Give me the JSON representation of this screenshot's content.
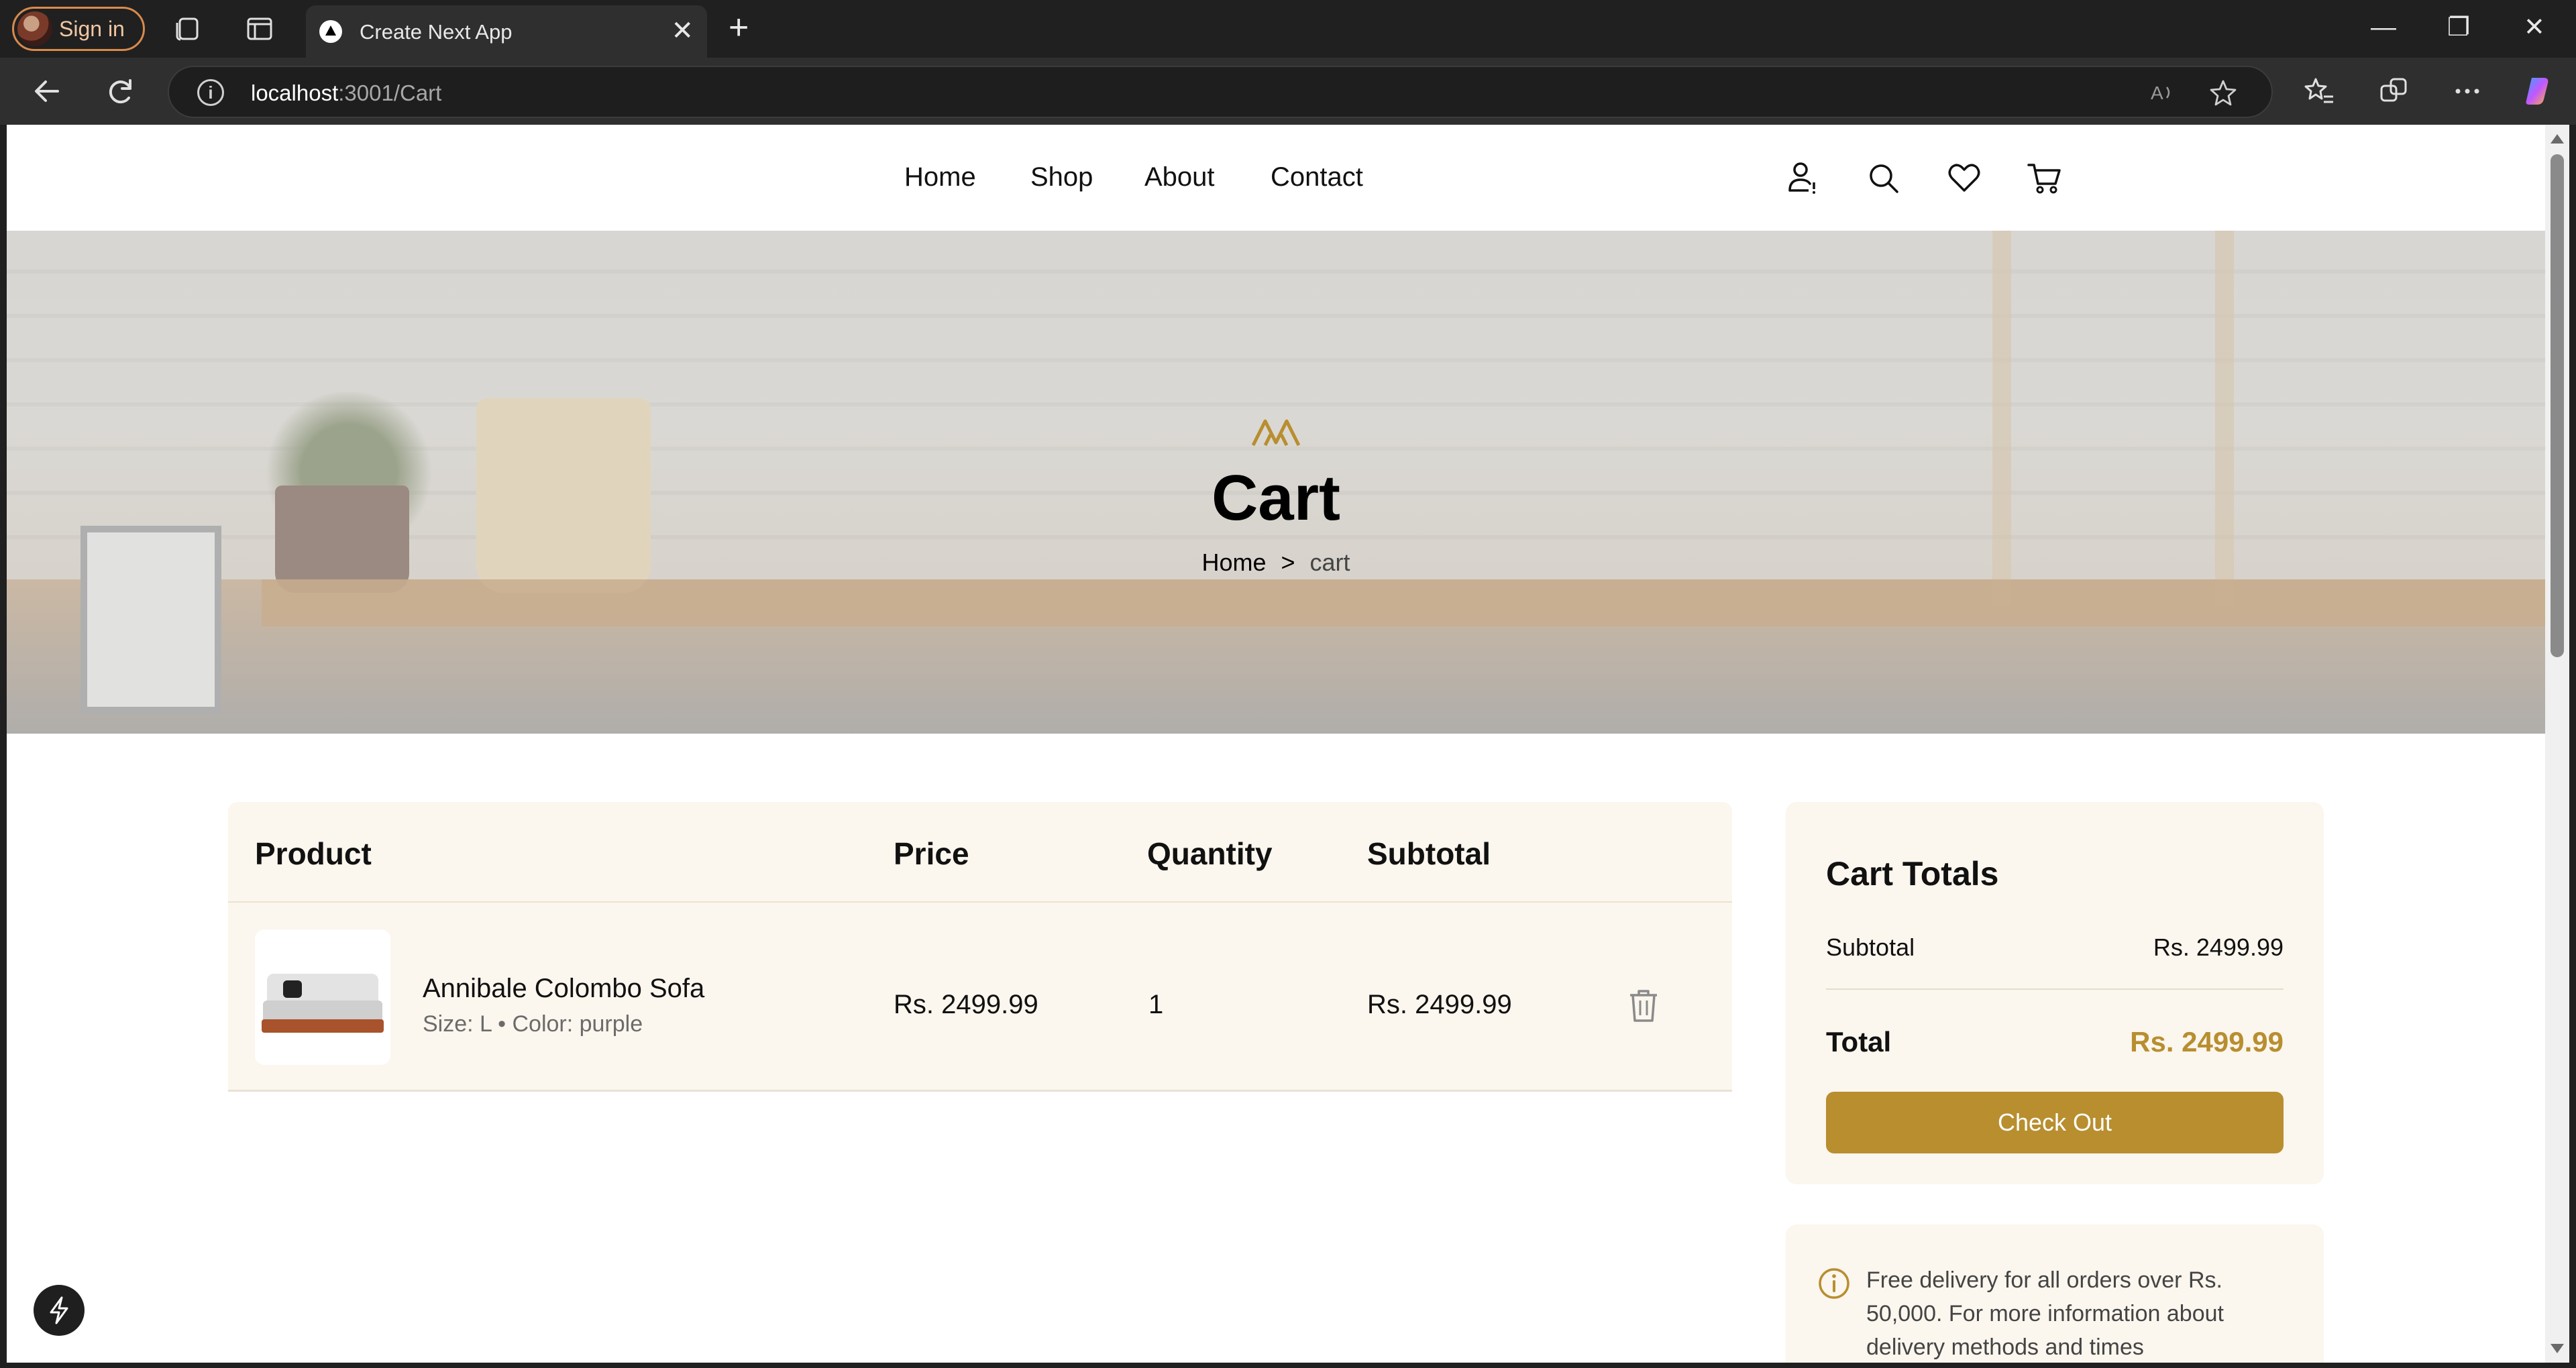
{
  "browser": {
    "signin_label": "Sign in",
    "tab_title": "Create Next App",
    "tab_close": "✕",
    "new_tab": "+",
    "url_host": "localhost",
    "url_path": ":3001/Cart",
    "win_min": "—",
    "win_restore": "❐",
    "win_close": "✕"
  },
  "header": {
    "nav": [
      "Home",
      "Shop",
      "About",
      "Contact"
    ]
  },
  "hero": {
    "title": "Cart",
    "breadcrumb_home": "Home",
    "breadcrumb_sep": ">",
    "breadcrumb_current": "cart"
  },
  "cart": {
    "columns": [
      "Product",
      "Price",
      "Quantity",
      "Subtotal"
    ],
    "items": [
      {
        "name": "Annibale Colombo Sofa",
        "meta": "Size: L • Color: purple",
        "price": "Rs. 2499.99",
        "quantity": "1",
        "subtotal": "Rs. 2499.99"
      }
    ]
  },
  "totals": {
    "title": "Cart Totals",
    "subtotal_label": "Subtotal",
    "subtotal_value": "Rs. 2499.99",
    "total_label": "Total",
    "total_value": "Rs. 2499.99",
    "checkout_label": "Check Out"
  },
  "notice": {
    "text": "Free delivery for all orders over Rs. 50,000. For more information about delivery methods and times"
  },
  "colors": {
    "accent": "#b88e2f",
    "panel_bg": "#fbf6ee"
  }
}
